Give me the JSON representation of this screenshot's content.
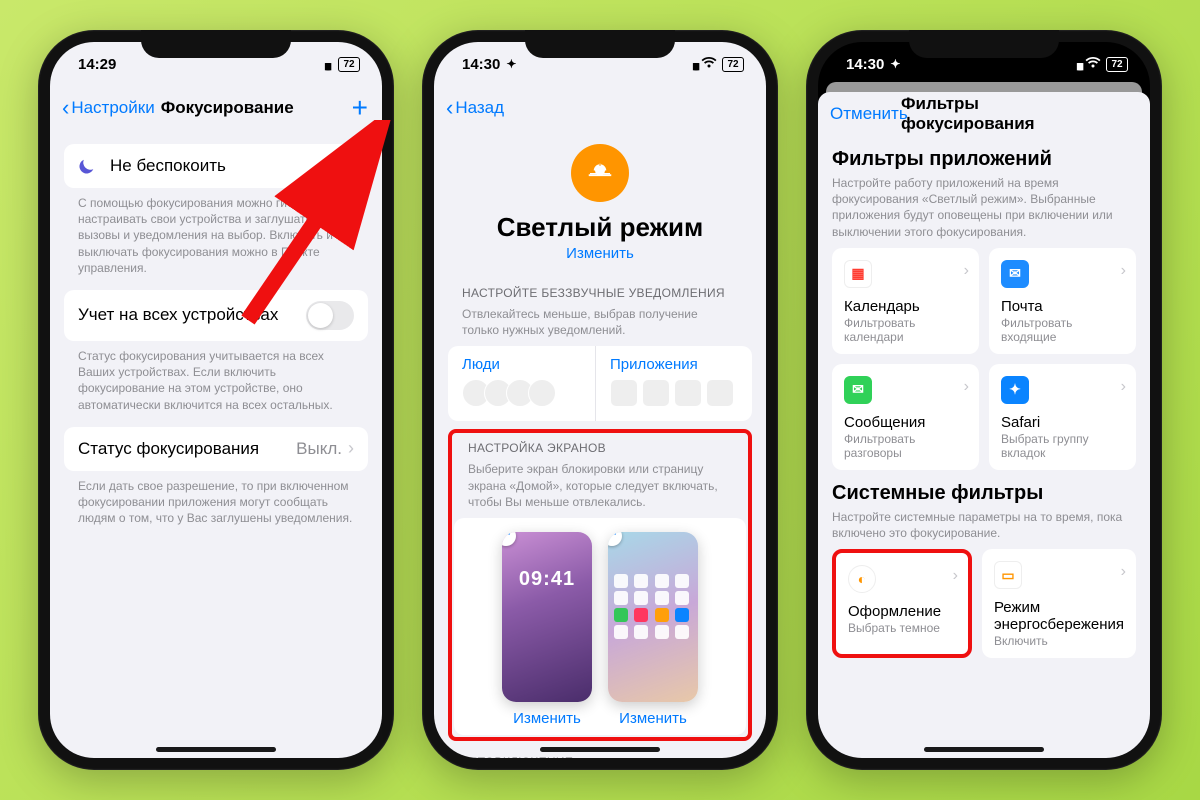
{
  "p1": {
    "time": "14:29",
    "battery": "72",
    "back": "Настройки",
    "title": "Фокусирование",
    "row_dnd": "Не беспокоить",
    "caption1": "С помощью фокусирования можно гибко настраивать свои устройства и заглушать вызовы и уведомления на выбор. Включать и выключать фокусирования можно в Пункте управления.",
    "row_share": "Учет на всех устройствах",
    "caption2": "Статус фокусирования учитывается на всех Ваших устройствах. Если включить фокусирование на этом устройстве, оно автоматически включится на всех остальных.",
    "row_status": "Статус фокусирования",
    "status_val": "Выкл.",
    "caption3": "Если дать свое разрешение, то при включенном фокусировании приложения могут сообщать людям о том, что у Вас заглушены уведомления."
  },
  "p2": {
    "time": "14:30",
    "battery": "72",
    "back": "Назад",
    "hero_title": "Светлый режим",
    "hero_link": "Изменить",
    "sec1_header": "НАСТРОЙТЕ БЕЗЗВУЧНЫЕ УВЕДОМЛЕНИЯ",
    "sec1_caption": "Отвлекайтесь меньше, выбрав получение только нужных уведомлений.",
    "people": "Люди",
    "apps": "Приложения",
    "sec2_header": "НАСТРОЙКА ЭКРАНОВ",
    "sec2_caption": "Выберите экран блокировки или страницу экрана «Домой», которые следует включать, чтобы Вы меньше отвлекались.",
    "mini_time": "09:41",
    "edit": "Изменить",
    "sec3_header": "АВТОВКЛЮЧЕНИЕ"
  },
  "p3": {
    "time": "14:30",
    "battery": "72",
    "cancel": "Отменить",
    "title": "Фильтры фокусирования",
    "sec1_title": "Фильтры приложений",
    "sec1_caption": "Настройте работу приложений на время фокусирования «Светлый режим». Выбранные приложения будут оповещены при включении или выключении этого фокусирования.",
    "tiles": [
      {
        "name": "Календарь",
        "sub": "Фильтровать календари",
        "color": "#ffffff",
        "fg": "#ff3b30",
        "sym": "📅"
      },
      {
        "name": "Почта",
        "sub": "Фильтровать входящие",
        "color": "#1e8cff",
        "fg": "#fff",
        "sym": "✉"
      },
      {
        "name": "Сообщения",
        "sub": "Фильтровать разговоры",
        "color": "#30d158",
        "fg": "#fff",
        "sym": "✉"
      },
      {
        "name": "Safari",
        "sub": "Выбрать группу вкладок",
        "color": "#0a84ff",
        "fg": "#fff",
        "sym": "✦"
      }
    ],
    "sec2_title": "Системные фильтры",
    "sec2_caption": "Настройте системные параметры на то время, пока включено это фокусирование.",
    "sys_tiles": [
      {
        "name": "Оформление",
        "sub": "Выбрать темное",
        "color": "#ff9500",
        "sym": "◐"
      },
      {
        "name": "Режим энергосбережения",
        "sub": "Включить",
        "color": "#ffffff",
        "fg": "#ff9500",
        "sym": "▢"
      }
    ]
  }
}
